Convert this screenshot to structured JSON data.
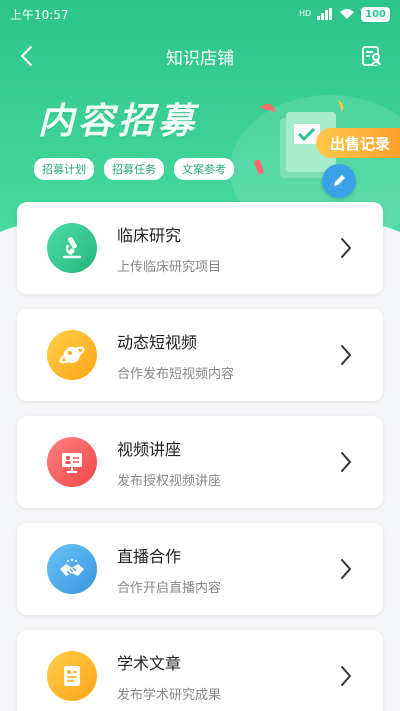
{
  "status_bar": {
    "time": "上午10:57",
    "battery": "100"
  },
  "nav": {
    "title": "知识店铺"
  },
  "banner": {
    "title": "内容招募",
    "tags": [
      "招募计划",
      "招募任务",
      "文案参考"
    ],
    "sales_button": "出售记录"
  },
  "colors": {
    "accent": "#2cc48a",
    "icon_clinical": "#2cc48a",
    "icon_video": "#ffb020",
    "icon_lecture": "#ff5f5f",
    "icon_live": "#3aa2e8",
    "icon_article": "#ffb020"
  },
  "cards": [
    {
      "title": "临床研究",
      "subtitle": "上传临床研究项目",
      "icon": "microscope-icon"
    },
    {
      "title": "动态短视频",
      "subtitle": "合作发布短视频内容",
      "icon": "planet-icon"
    },
    {
      "title": "视频讲座",
      "subtitle": "发布授权视频讲座",
      "icon": "presentation-icon"
    },
    {
      "title": "直播合作",
      "subtitle": "合作开启直播内容",
      "icon": "handshake-icon"
    },
    {
      "title": "学术文章",
      "subtitle": "发布学术研究成果",
      "icon": "document-icon"
    }
  ]
}
